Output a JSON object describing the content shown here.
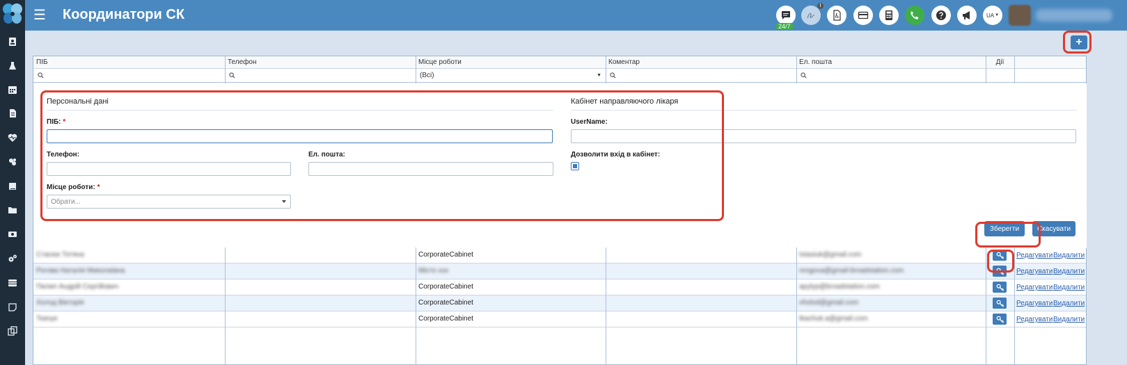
{
  "app": {
    "title": "Координатори СК"
  },
  "topbar": {
    "chat_badge": "24/7",
    "notif_count": "!",
    "lang": "UA"
  },
  "sidebar": {
    "icons": [
      "contact-card-icon",
      "flask-icon",
      "calendar-icon",
      "document-icon",
      "heartbeat-icon",
      "bacteria-icon",
      "book-icon",
      "folder-icon",
      "money-icon",
      "gears-icon",
      "list-icon",
      "note-icon",
      "copy-icon"
    ]
  },
  "grid": {
    "columns": [
      "ПІБ",
      "Телефон",
      "Місце роботи",
      "Коментар",
      "Ел. пошта",
      "Дії"
    ],
    "filter_workplace": "(Всі)"
  },
  "form": {
    "personal_title": "Персональні дані",
    "cabinet_title": "Кабінет направляючого лікаря",
    "pib_label": "ПІБ:",
    "pib_value": "",
    "phone_label": "Телефон:",
    "email_label": "Ел. пошта:",
    "workplace_label": "Місце роботи:",
    "workplace_placeholder": "Обрати...",
    "username_label": "UserName:",
    "allow_login_label": "Дозволити вхід в кабінет:",
    "required_mark": "*",
    "save_label": "Зберегти",
    "cancel_label": "Скасувати"
  },
  "rows": [
    {
      "name": "Стасюк Тетяна",
      "phone": "",
      "workplace": "CorporateCabinet",
      "comment": "",
      "email": "tstasiuk@gmail.com"
    },
    {
      "name": "Рогова Наталія Миколаївна",
      "phone": "",
      "workplace": "Місто ххх",
      "comment": "",
      "email": "nrogova@gmail-broadstation.com"
    },
    {
      "name": "Пилип Андрій Сергійович",
      "phone": "",
      "workplace": "CorporateCabinet",
      "comment": "",
      "email": "apylyp@broadstation.com"
    },
    {
      "name": "Холод Вікторія",
      "phone": "",
      "workplace": "CorporateCabinet",
      "comment": "",
      "email": "vholod@gmail.com"
    },
    {
      "name": "Ткачук",
      "phone": "",
      "workplace": "CorporateCabinet",
      "comment": "",
      "email": "tkachuk.a@gmail.com"
    }
  ],
  "row_actions": {
    "edit": "Редагувати",
    "delete": "Видалити"
  }
}
